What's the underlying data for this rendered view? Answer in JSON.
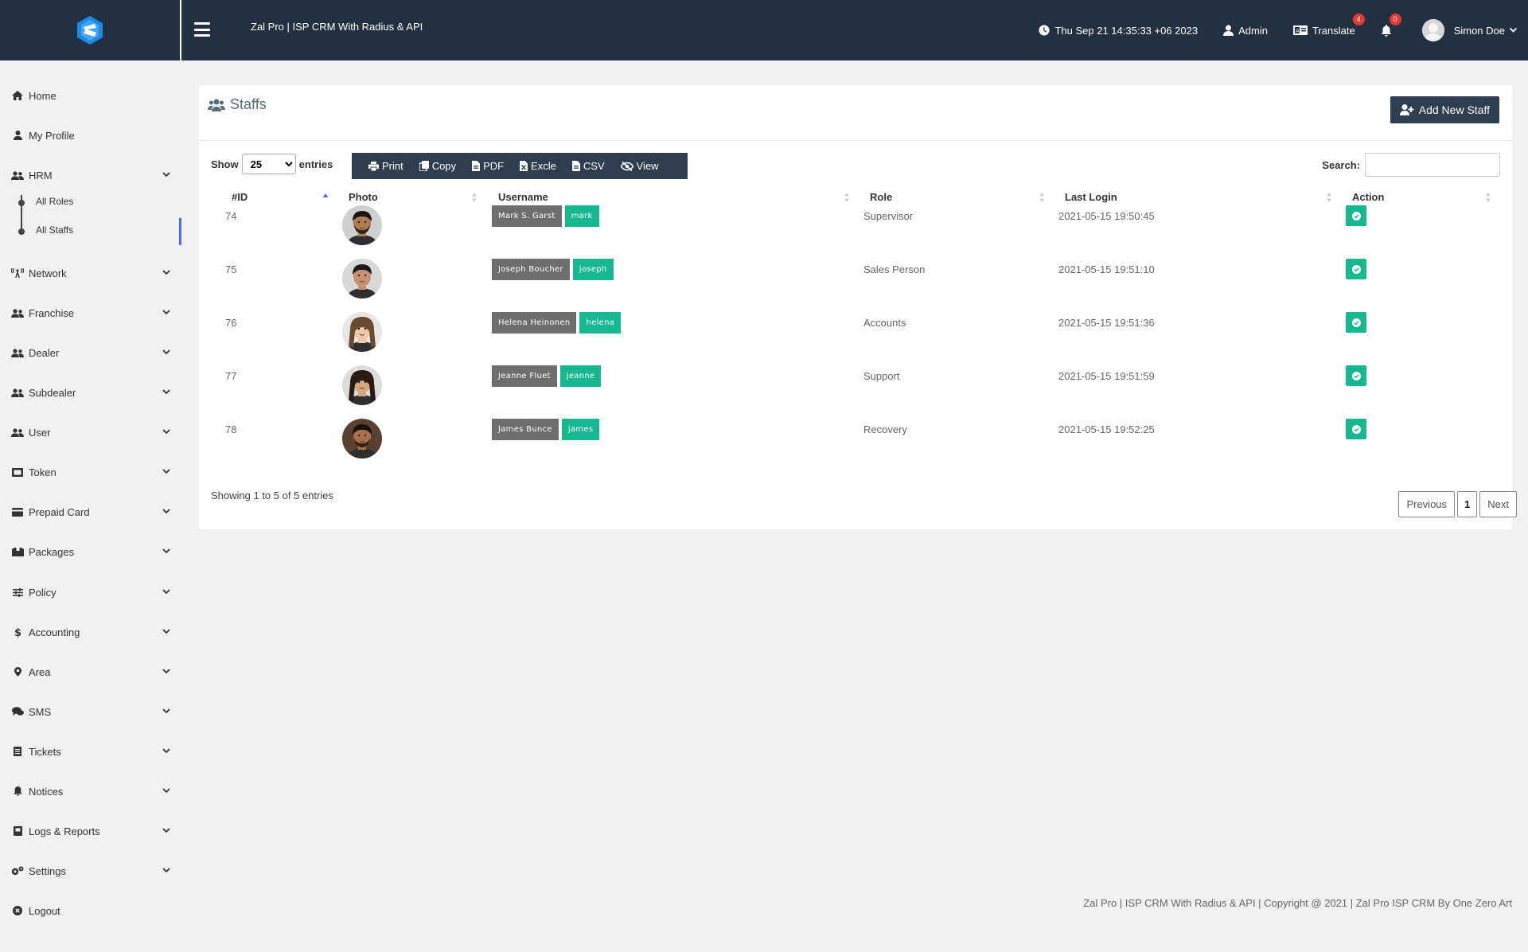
{
  "header": {
    "app_title": "Zal Pro | ISP CRM With Radius & API",
    "datetime": "Thu Sep 21 14:35:33 +06 2023",
    "admin_label": "Admin",
    "translate_label": "Translate",
    "translate_badge": "4",
    "notifications_badge": "0",
    "user_name": "Simon Doe"
  },
  "sidebar": {
    "items": [
      {
        "label": "Home",
        "icon": "home-icon"
      },
      {
        "label": "My Profile",
        "icon": "user-icon"
      },
      {
        "label": "HRM",
        "icon": "users-icon"
      },
      {
        "label": "Network",
        "icon": "antenna-icon"
      },
      {
        "label": "Franchise",
        "icon": "users-icon"
      },
      {
        "label": "Dealer",
        "icon": "users-icon"
      },
      {
        "label": "Subdealer",
        "icon": "users-icon"
      },
      {
        "label": "User",
        "icon": "users-icon"
      },
      {
        "label": "Token",
        "icon": "ticket-icon"
      },
      {
        "label": "Prepaid Card",
        "icon": "card-icon"
      },
      {
        "label": "Packages",
        "icon": "box-icon"
      },
      {
        "label": "Policy",
        "icon": "sliders-icon"
      },
      {
        "label": "Accounting",
        "icon": "dollar-icon"
      },
      {
        "label": "Area",
        "icon": "map-pin-icon"
      },
      {
        "label": "SMS",
        "icon": "chat-icon"
      },
      {
        "label": "Tickets",
        "icon": "file-icon"
      },
      {
        "label": "Notices",
        "icon": "bell-icon"
      },
      {
        "label": "Logs & Reports",
        "icon": "book-icon"
      },
      {
        "label": "Settings",
        "icon": "gears-icon"
      },
      {
        "label": "Logout",
        "icon": "power-icon"
      }
    ],
    "hrm_sub": [
      "All Roles",
      "All Staffs"
    ]
  },
  "page": {
    "title": "Staffs",
    "add_button": "Add New Staff",
    "show_label": "Show",
    "entries_label": "entries",
    "page_length": "25",
    "search_label": "Search:",
    "search_value": "",
    "export_buttons": [
      "Print",
      "Copy",
      "PDF",
      "Excle",
      "CSV",
      "View"
    ]
  },
  "table": {
    "columns": [
      "#ID",
      "Photo",
      "Username",
      "Role",
      "Last Login",
      "Action"
    ],
    "rows": [
      {
        "id": "74",
        "name": "Mark S. Garst",
        "username": "mark",
        "role": "Supervisor",
        "last_login": "2021-05-15 19:50:45"
      },
      {
        "id": "75",
        "name": "Joseph Boucher",
        "username": "joseph",
        "role": "Sales Person",
        "last_login": "2021-05-15 19:51:10"
      },
      {
        "id": "76",
        "name": "Helena Heinonen",
        "username": "helena",
        "role": "Accounts",
        "last_login": "2021-05-15 19:51:36"
      },
      {
        "id": "77",
        "name": "Jeanne Fluet",
        "username": "jeanne",
        "role": "Support",
        "last_login": "2021-05-15 19:51:59"
      },
      {
        "id": "78",
        "name": "James Bunce",
        "username": "james",
        "role": "Recovery",
        "last_login": "2021-05-15 19:52:25"
      }
    ],
    "info": "Showing 1 to 5 of 5 entries"
  },
  "pagination": {
    "previous": "Previous",
    "current": "1",
    "next": "Next"
  },
  "footer": "Zal Pro | ISP CRM With Radius & API | Copyright @ 2021 | Zal Pro ISP CRM By One Zero Art"
}
